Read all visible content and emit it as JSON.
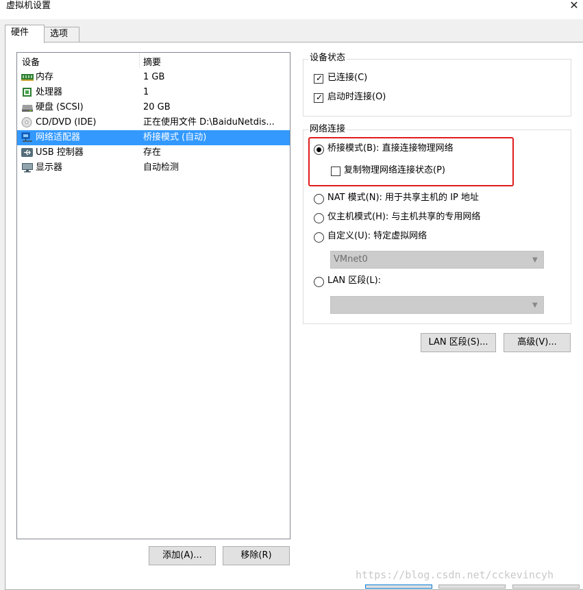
{
  "window": {
    "title": "虚拟机设置",
    "close_glyph": "✕"
  },
  "tabs": [
    {
      "label": "硬件",
      "active": true
    },
    {
      "label": "选项",
      "active": false
    }
  ],
  "device_list": {
    "columns": [
      "设备",
      "摘要"
    ],
    "rows": [
      {
        "name": "内存",
        "summary": "1 GB",
        "icon": "memory-icon"
      },
      {
        "name": "处理器",
        "summary": "1",
        "icon": "processor-icon"
      },
      {
        "name": "硬盘 (SCSI)",
        "summary": "20 GB",
        "icon": "hard-disk-icon"
      },
      {
        "name": "CD/DVD (IDE)",
        "summary": "正在使用文件 D:\\BaiduNetdis...",
        "icon": "cd-dvd-icon"
      },
      {
        "name": "网络适配器",
        "summary": "桥接模式 (自动)",
        "icon": "network-adapter-icon",
        "selected": true
      },
      {
        "name": "USB 控制器",
        "summary": "存在",
        "icon": "usb-icon"
      },
      {
        "name": "显示器",
        "summary": "自动检测",
        "icon": "display-icon"
      }
    ]
  },
  "list_buttons": {
    "add": "添加(A)...",
    "remove": "移除(R)"
  },
  "device_status": {
    "legend": "设备状态",
    "connected": {
      "label": "已连接(C)",
      "checked": true
    },
    "connect_at_power_on": {
      "label": "启动时连接(O)",
      "checked": true
    }
  },
  "network_connection": {
    "legend": "网络连接",
    "bridged": {
      "label": "桥接模式(B): 直接连接物理网络",
      "selected": true
    },
    "replicate": {
      "label": "复制物理网络连接状态(P)",
      "checked": false
    },
    "nat": {
      "label": "NAT 模式(N): 用于共享主机的 IP 地址",
      "selected": false
    },
    "host_only": {
      "label": "仅主机模式(H): 与主机共享的专用网络",
      "selected": false
    },
    "custom": {
      "label": "自定义(U): 特定虚拟网络",
      "selected": false
    },
    "custom_select_value": "VMnet0",
    "lan_segment": {
      "label": "LAN 区段(L):",
      "selected": false
    },
    "lan_select_value": ""
  },
  "action_buttons": {
    "lan_segments": "LAN 区段(S)...",
    "advanced": "高级(V)..."
  },
  "watermark": "https://blog.csdn.net/cckevincyh",
  "colors": {
    "selection": "#3399ff",
    "highlight_box": "#e01b1b"
  }
}
